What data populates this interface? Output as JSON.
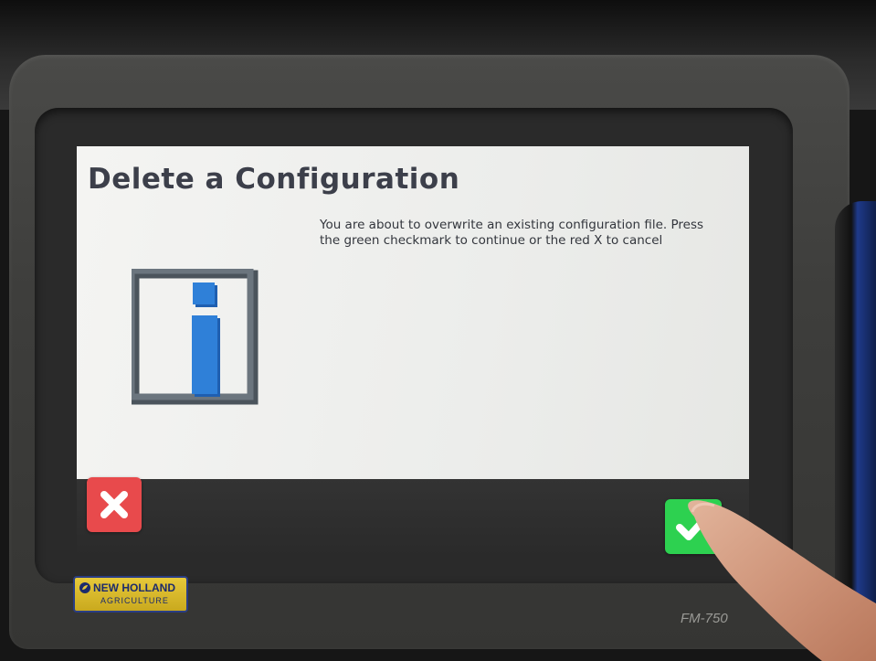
{
  "dialog": {
    "title": "Delete a Configuration",
    "message": "You are about to overwrite an existing configuration file. Press the green checkmark to continue or the red X to cancel",
    "icon": "info-icon"
  },
  "buttons": {
    "cancel": {
      "icon": "close-icon",
      "color": "#e84a4c"
    },
    "confirm": {
      "icon": "checkmark-icon",
      "color": "#2dd150"
    }
  },
  "device": {
    "brand_name": "NEW HOLLAND",
    "brand_sub": "AGRICULTURE",
    "model": "FM-750"
  },
  "colors": {
    "title": "#3c3f4a",
    "info_blue": "#2f7fd6",
    "info_frame": "#5c6670"
  }
}
